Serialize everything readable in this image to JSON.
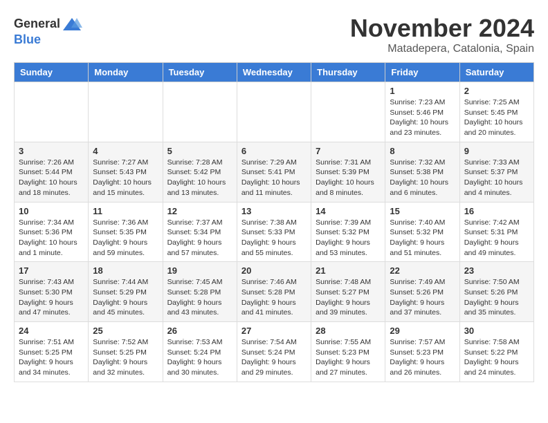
{
  "logo": {
    "text_general": "General",
    "text_blue": "Blue"
  },
  "title": "November 2024",
  "subtitle": "Matadepera, Catalonia, Spain",
  "days_of_week": [
    "Sunday",
    "Monday",
    "Tuesday",
    "Wednesday",
    "Thursday",
    "Friday",
    "Saturday"
  ],
  "weeks": [
    [
      {
        "day": "",
        "info": ""
      },
      {
        "day": "",
        "info": ""
      },
      {
        "day": "",
        "info": ""
      },
      {
        "day": "",
        "info": ""
      },
      {
        "day": "",
        "info": ""
      },
      {
        "day": "1",
        "info": "Sunrise: 7:23 AM\nSunset: 5:46 PM\nDaylight: 10 hours\nand 23 minutes."
      },
      {
        "day": "2",
        "info": "Sunrise: 7:25 AM\nSunset: 5:45 PM\nDaylight: 10 hours\nand 20 minutes."
      }
    ],
    [
      {
        "day": "3",
        "info": "Sunrise: 7:26 AM\nSunset: 5:44 PM\nDaylight: 10 hours\nand 18 minutes."
      },
      {
        "day": "4",
        "info": "Sunrise: 7:27 AM\nSunset: 5:43 PM\nDaylight: 10 hours\nand 15 minutes."
      },
      {
        "day": "5",
        "info": "Sunrise: 7:28 AM\nSunset: 5:42 PM\nDaylight: 10 hours\nand 13 minutes."
      },
      {
        "day": "6",
        "info": "Sunrise: 7:29 AM\nSunset: 5:41 PM\nDaylight: 10 hours\nand 11 minutes."
      },
      {
        "day": "7",
        "info": "Sunrise: 7:31 AM\nSunset: 5:39 PM\nDaylight: 10 hours\nand 8 minutes."
      },
      {
        "day": "8",
        "info": "Sunrise: 7:32 AM\nSunset: 5:38 PM\nDaylight: 10 hours\nand 6 minutes."
      },
      {
        "day": "9",
        "info": "Sunrise: 7:33 AM\nSunset: 5:37 PM\nDaylight: 10 hours\nand 4 minutes."
      }
    ],
    [
      {
        "day": "10",
        "info": "Sunrise: 7:34 AM\nSunset: 5:36 PM\nDaylight: 10 hours\nand 1 minute."
      },
      {
        "day": "11",
        "info": "Sunrise: 7:36 AM\nSunset: 5:35 PM\nDaylight: 9 hours\nand 59 minutes."
      },
      {
        "day": "12",
        "info": "Sunrise: 7:37 AM\nSunset: 5:34 PM\nDaylight: 9 hours\nand 57 minutes."
      },
      {
        "day": "13",
        "info": "Sunrise: 7:38 AM\nSunset: 5:33 PM\nDaylight: 9 hours\nand 55 minutes."
      },
      {
        "day": "14",
        "info": "Sunrise: 7:39 AM\nSunset: 5:32 PM\nDaylight: 9 hours\nand 53 minutes."
      },
      {
        "day": "15",
        "info": "Sunrise: 7:40 AM\nSunset: 5:32 PM\nDaylight: 9 hours\nand 51 minutes."
      },
      {
        "day": "16",
        "info": "Sunrise: 7:42 AM\nSunset: 5:31 PM\nDaylight: 9 hours\nand 49 minutes."
      }
    ],
    [
      {
        "day": "17",
        "info": "Sunrise: 7:43 AM\nSunset: 5:30 PM\nDaylight: 9 hours\nand 47 minutes."
      },
      {
        "day": "18",
        "info": "Sunrise: 7:44 AM\nSunset: 5:29 PM\nDaylight: 9 hours\nand 45 minutes."
      },
      {
        "day": "19",
        "info": "Sunrise: 7:45 AM\nSunset: 5:28 PM\nDaylight: 9 hours\nand 43 minutes."
      },
      {
        "day": "20",
        "info": "Sunrise: 7:46 AM\nSunset: 5:28 PM\nDaylight: 9 hours\nand 41 minutes."
      },
      {
        "day": "21",
        "info": "Sunrise: 7:48 AM\nSunset: 5:27 PM\nDaylight: 9 hours\nand 39 minutes."
      },
      {
        "day": "22",
        "info": "Sunrise: 7:49 AM\nSunset: 5:26 PM\nDaylight: 9 hours\nand 37 minutes."
      },
      {
        "day": "23",
        "info": "Sunrise: 7:50 AM\nSunset: 5:26 PM\nDaylight: 9 hours\nand 35 minutes."
      }
    ],
    [
      {
        "day": "24",
        "info": "Sunrise: 7:51 AM\nSunset: 5:25 PM\nDaylight: 9 hours\nand 34 minutes."
      },
      {
        "day": "25",
        "info": "Sunrise: 7:52 AM\nSunset: 5:25 PM\nDaylight: 9 hours\nand 32 minutes."
      },
      {
        "day": "26",
        "info": "Sunrise: 7:53 AM\nSunset: 5:24 PM\nDaylight: 9 hours\nand 30 minutes."
      },
      {
        "day": "27",
        "info": "Sunrise: 7:54 AM\nSunset: 5:24 PM\nDaylight: 9 hours\nand 29 minutes."
      },
      {
        "day": "28",
        "info": "Sunrise: 7:55 AM\nSunset: 5:23 PM\nDaylight: 9 hours\nand 27 minutes."
      },
      {
        "day": "29",
        "info": "Sunrise: 7:57 AM\nSunset: 5:23 PM\nDaylight: 9 hours\nand 26 minutes."
      },
      {
        "day": "30",
        "info": "Sunrise: 7:58 AM\nSunset: 5:22 PM\nDaylight: 9 hours\nand 24 minutes."
      }
    ]
  ]
}
